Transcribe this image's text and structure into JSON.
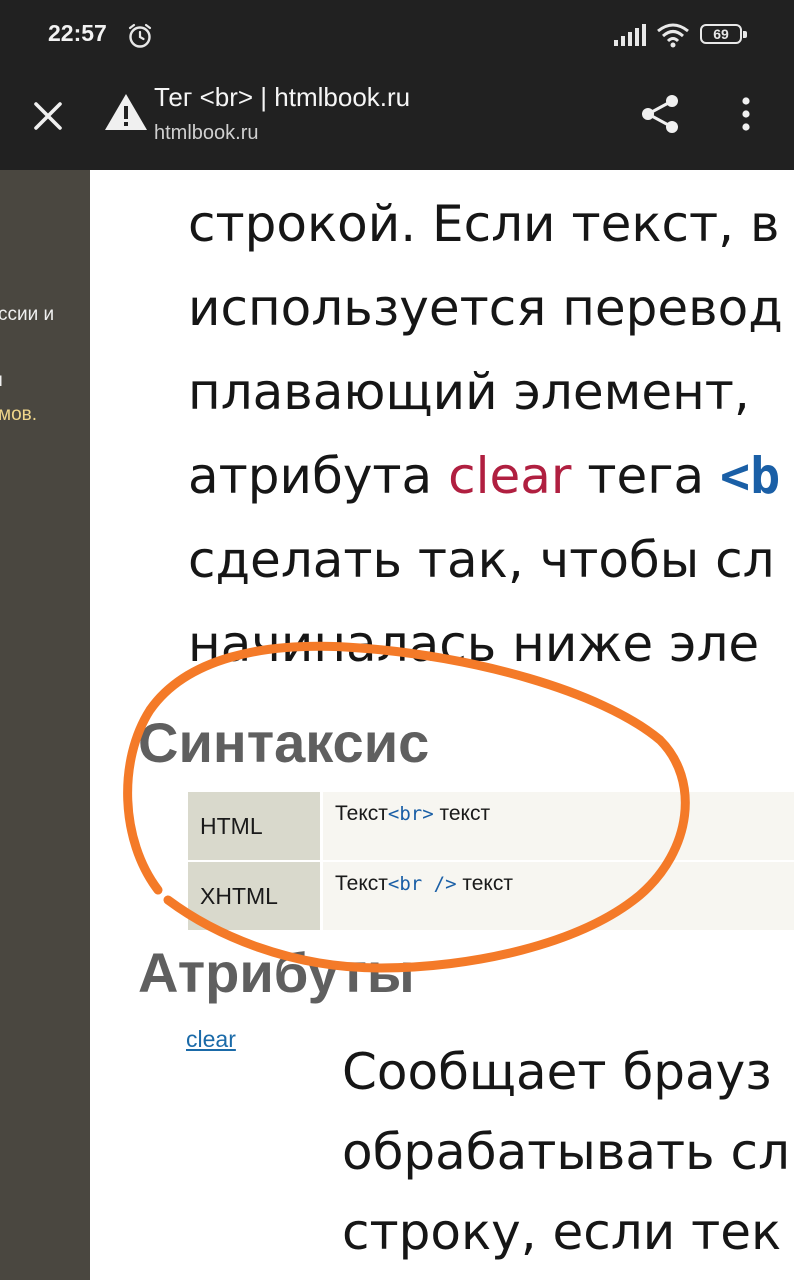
{
  "status_bar": {
    "time": "22:57",
    "battery_level": "69",
    "icons": [
      "alarm-icon",
      "signal-icon",
      "wifi-icon",
      "battery-icon"
    ]
  },
  "toolbar": {
    "title": "Тег <br> | htmlbook.ru",
    "url": "htmlbook.ru",
    "icons": [
      "close-icon",
      "warning-icon",
      "share-icon",
      "more-vert-icon"
    ]
  },
  "sidebar": {
    "line1": "ссии и",
    "line2": "ı",
    "line3": "мов."
  },
  "article": {
    "line1": "строкой. Если текст, в",
    "line2": "используется перевод",
    "line3": "плавающий элемент, ",
    "line4_pre": "атрибута ",
    "line4_attr": "clear",
    "line4_mid": " тега ",
    "line4_tag": "<b",
    "line5": "сделать так, чтобы сл",
    "line6": "начиналась ниже эле"
  },
  "syntax": {
    "heading": "Синтаксис",
    "rows": [
      {
        "lang": "HTML",
        "pre": "Текст",
        "tag": "<br>",
        "post": " текст"
      },
      {
        "lang": "XHTML",
        "pre": "Текст",
        "tag": "<br />",
        "post": " текст"
      }
    ]
  },
  "attributes": {
    "heading": "Атрибуты",
    "link": "clear",
    "desc1": "Сообщает брауз",
    "desc2": "обрабатывать сл",
    "desc3": "строку, если тек"
  },
  "colors": {
    "bar_bg": "#212121",
    "sidebar_bg": "#4a4740",
    "highlight_circle": "#f47a28",
    "attr_red": "#b01f40",
    "tag_blue": "#1a5fa6"
  }
}
